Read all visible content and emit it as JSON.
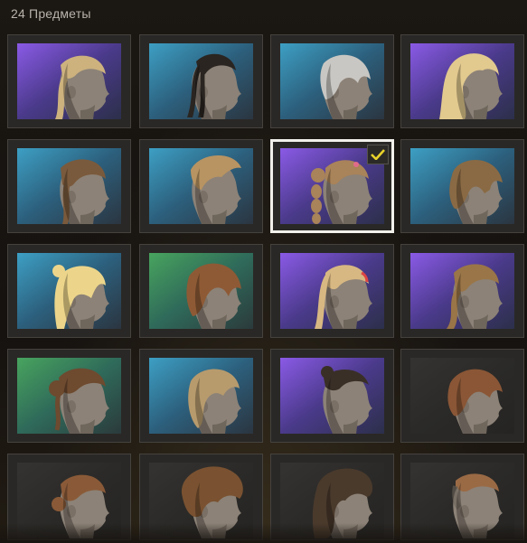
{
  "header": {
    "count_label": "24 Предметы"
  },
  "colors": {
    "purple_card": "#7a4fd6",
    "blue_card": "#3b8fb6",
    "green_card": "#3f8f56",
    "grey_card": "#2e2d2b",
    "check_yellow": "#e8d22a",
    "selected_border": "#f2f0ea"
  },
  "items": [
    {
      "name": "hair-01",
      "bg": "purple",
      "hair": "#cdb27e",
      "style": "braid-crown",
      "selected": false
    },
    {
      "name": "hair-02",
      "bg": "blue",
      "hair": "#2a2521",
      "style": "high-braids",
      "selected": false
    },
    {
      "name": "hair-03",
      "bg": "blue",
      "hair": "#c9c7c3",
      "style": "short-bob",
      "selected": false
    },
    {
      "name": "hair-04",
      "bg": "purple",
      "hair": "#e2c98e",
      "style": "long-wavy",
      "selected": false
    },
    {
      "name": "hair-05",
      "bg": "blue",
      "hair": "#7a5a3c",
      "style": "side-braid",
      "selected": false
    },
    {
      "name": "hair-06",
      "bg": "blue",
      "hair": "#b89462",
      "style": "quiff",
      "selected": false
    },
    {
      "name": "hair-07",
      "bg": "purple",
      "hair": "#a98359",
      "style": "bubble-ponytail",
      "selected": true
    },
    {
      "name": "hair-08",
      "bg": "blue",
      "hair": "#8a6a44",
      "style": "bowl-bob",
      "selected": false
    },
    {
      "name": "hair-09",
      "bg": "blue",
      "hair": "#ecd58a",
      "style": "messy-bun",
      "selected": false
    },
    {
      "name": "hair-10",
      "bg": "green",
      "hair": "#8e5a35",
      "style": "bob-bangs",
      "selected": false
    },
    {
      "name": "hair-11",
      "bg": "purple",
      "hair": "#d8b882",
      "style": "high-ponytail",
      "selected": false
    },
    {
      "name": "hair-12",
      "bg": "purple",
      "hair": "#9a7547",
      "style": "low-braid",
      "selected": false
    },
    {
      "name": "hair-13",
      "bg": "green",
      "hair": "#6e4a2f",
      "style": "braided-updo",
      "selected": false
    },
    {
      "name": "hair-14",
      "bg": "blue",
      "hair": "#b79b6d",
      "style": "layered-bob",
      "selected": false
    },
    {
      "name": "hair-15",
      "bg": "purple",
      "hair": "#3a2f27",
      "style": "cornrows",
      "selected": false
    },
    {
      "name": "hair-16",
      "bg": "grey",
      "hair": "#8a5636",
      "style": "side-part",
      "selected": false
    },
    {
      "name": "hair-17",
      "bg": "grey",
      "hair": "#8a5a38",
      "style": "low-bun",
      "selected": false
    },
    {
      "name": "hair-18",
      "bg": "grey",
      "hair": "#7a5231",
      "style": "afro",
      "selected": false
    },
    {
      "name": "hair-19",
      "bg": "grey",
      "hair": "#4a3a2c",
      "style": "curly",
      "selected": false
    },
    {
      "name": "hair-20",
      "bg": "grey",
      "hair": "#9a6a45",
      "style": "undercut",
      "selected": false
    }
  ]
}
